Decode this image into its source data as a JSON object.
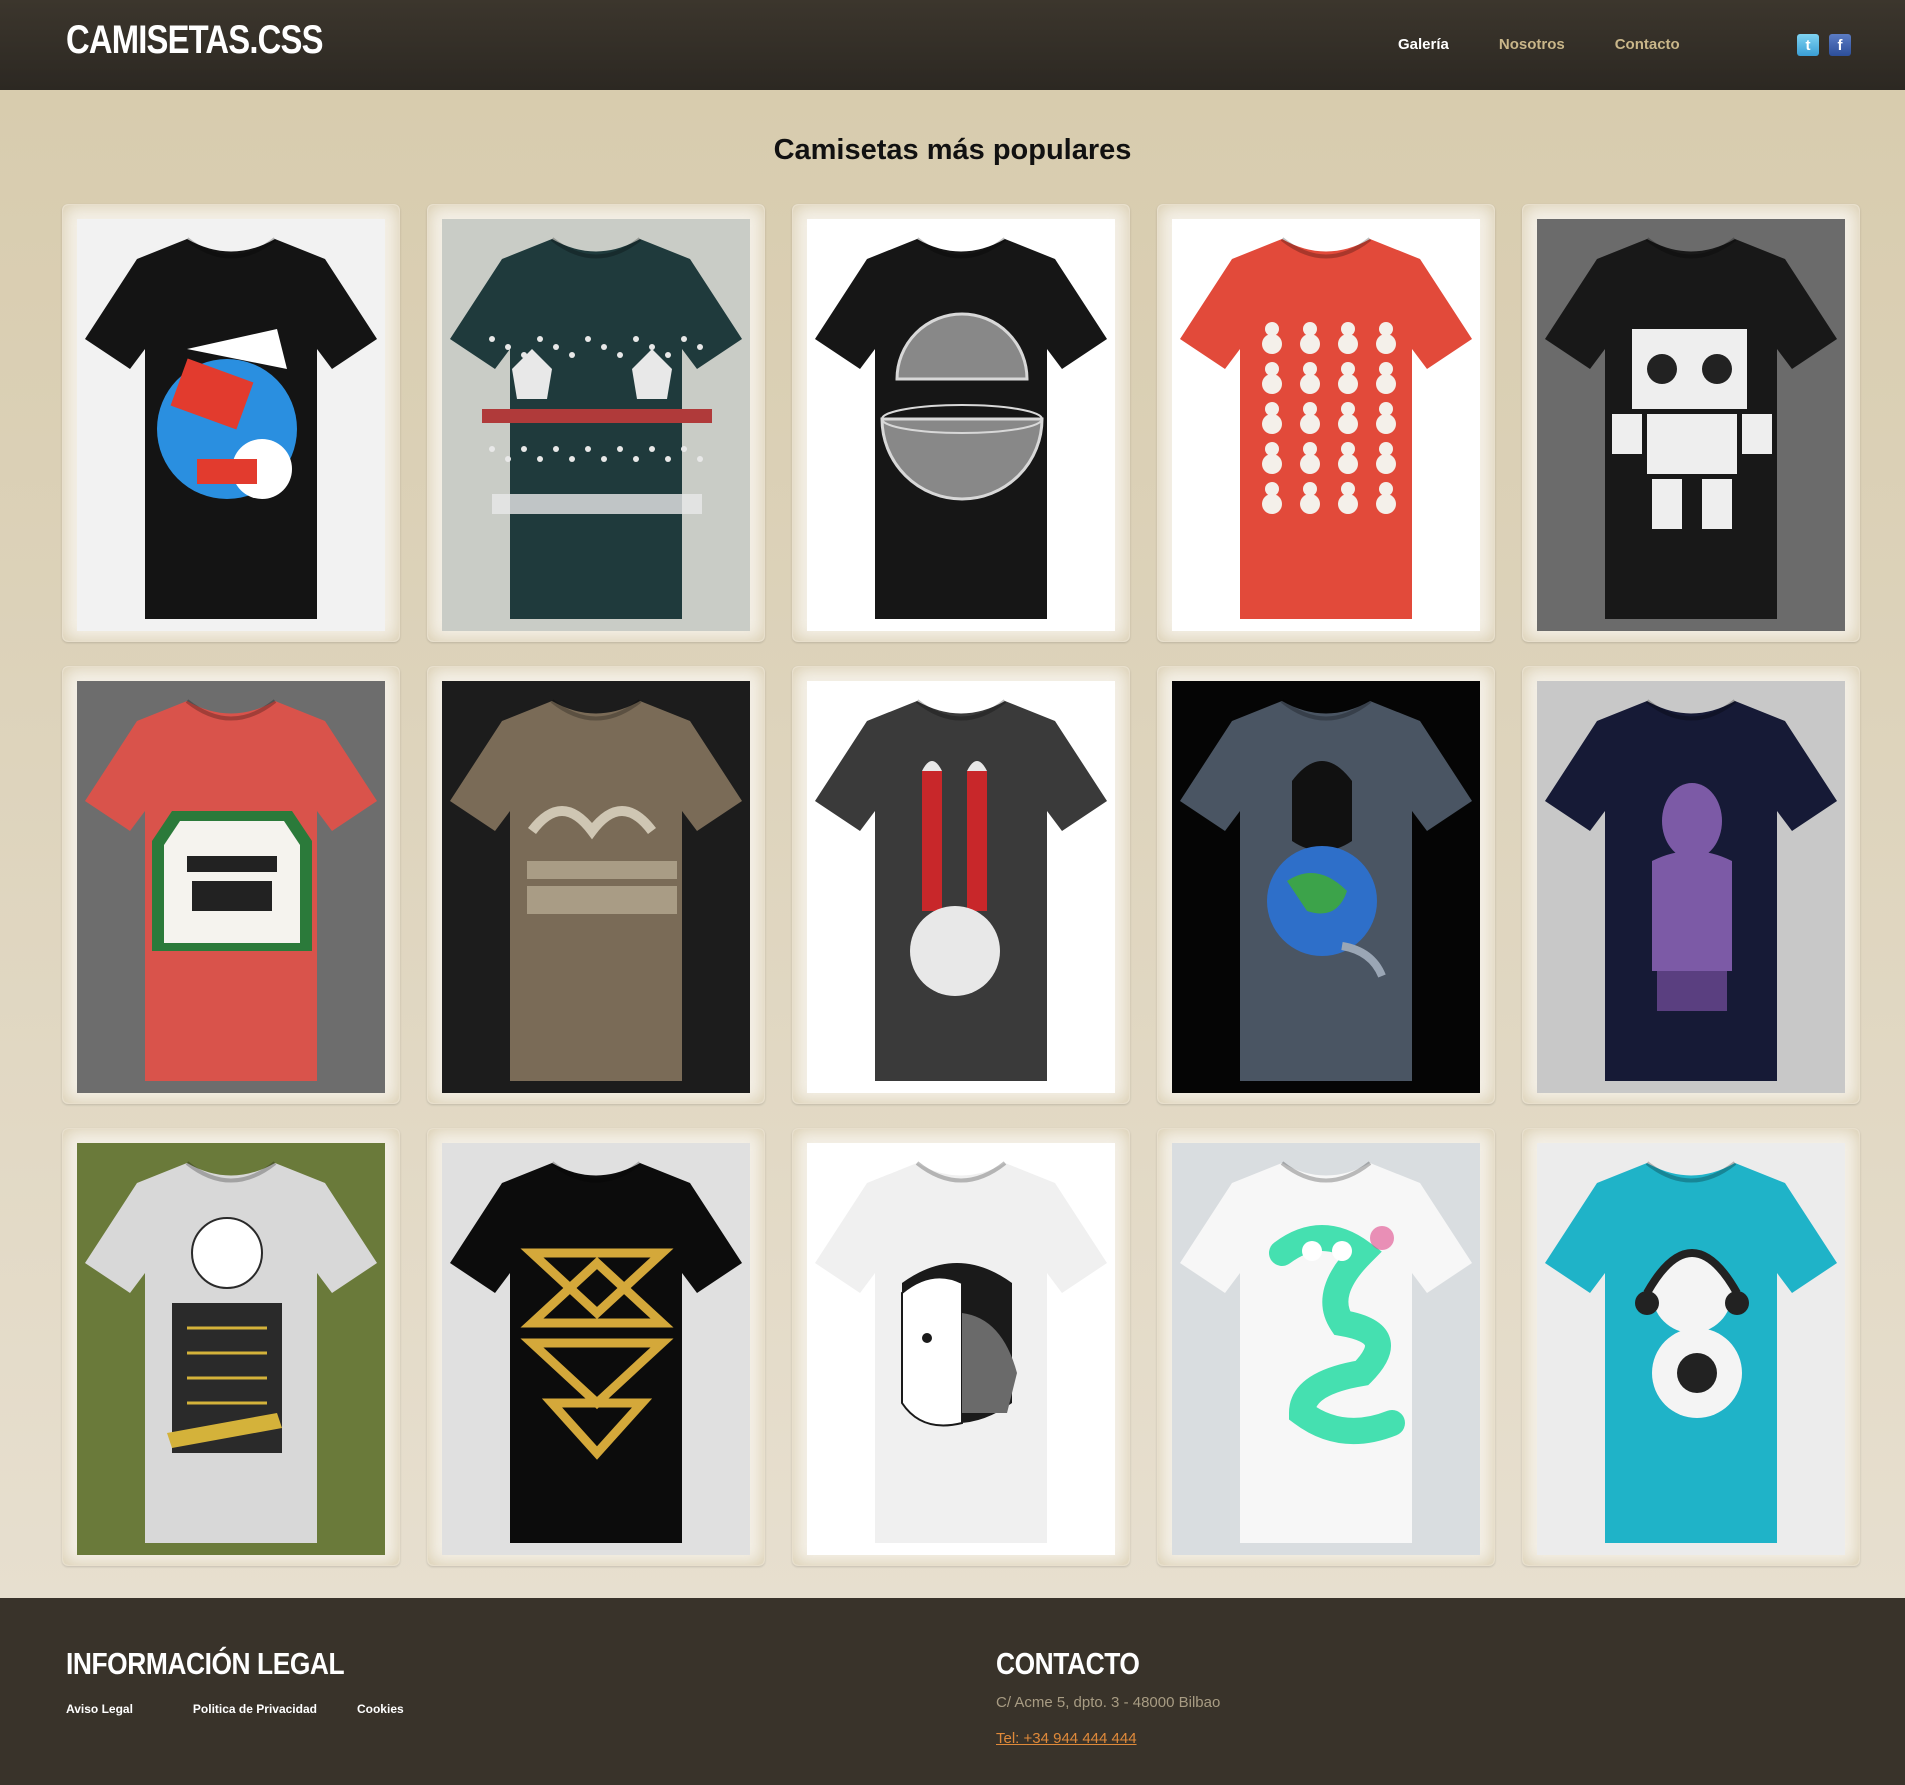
{
  "header": {
    "logo": "CAMISETAS.CSS",
    "nav": [
      {
        "label": "Galería",
        "active": true
      },
      {
        "label": "Nosotros",
        "active": false
      },
      {
        "label": "Contacto",
        "active": false
      }
    ],
    "social": {
      "twitter": "t",
      "facebook": "f"
    }
  },
  "main": {
    "title": "Camisetas más populares"
  },
  "shirts": [
    {
      "name": "abstract-colorful-black",
      "bg": "#f2f2f2",
      "shirt": "#141414",
      "print": "#2a8fe0",
      "print2": "#e23b2e",
      "motif": "abstract"
    },
    {
      "name": "reindeer-sweater-teal",
      "bg": "#c9ccc6",
      "shirt": "#1f3a3c",
      "print": "#e8e8e8",
      "print2": "#b03a3a",
      "motif": "reindeer"
    },
    {
      "name": "sphere-split-black",
      "bg": "#ffffff",
      "shirt": "#161616",
      "print": "#d8d8d8",
      "print2": "#888888",
      "motif": "sphere"
    },
    {
      "name": "snowmen-red",
      "bg": "#ffffff",
      "shirt": "#e24a3a",
      "print": "#f4f0ea",
      "print2": "#b33325",
      "motif": "snowmen"
    },
    {
      "name": "robot-black",
      "bg": "#6b6b6b",
      "shirt": "#181818",
      "print": "#eeeeee",
      "print2": "#222222",
      "motif": "robot"
    },
    {
      "name": "bassface-filthy-nasty",
      "bg": "#6d6d6d",
      "shirt": "#d9534b",
      "print": "#f5f3ee",
      "print2": "#2b7a3a",
      "motif": "label"
    },
    {
      "name": "better-than-i-deserve",
      "bg": "#1c1c1c",
      "shirt": "#7a6b57",
      "print": "#cfc6b3",
      "print2": "#a99c85",
      "motif": "text"
    },
    {
      "name": "rabbit-ears-gray",
      "bg": "#ffffff",
      "shirt": "#3a3a3a",
      "print": "#c8272a",
      "print2": "#e8e8e8",
      "motif": "rabbit"
    },
    {
      "name": "please-stop-earth",
      "bg": "#050505",
      "shirt": "#4a5563",
      "print": "#2e6fc9",
      "print2": "#3ca34a",
      "motif": "earth"
    },
    {
      "name": "purple-girl-navy",
      "bg": "#c8c8c8",
      "shirt": "#161a36",
      "print": "#7c5aa6",
      "print2": "#5a3f80",
      "motif": "figure"
    },
    {
      "name": "captain-illustration-gray",
      "bg": "#6a7a3a",
      "shirt": "#d8d8d8",
      "print": "#2a2a2a",
      "print2": "#d4b23a",
      "motif": "captain"
    },
    {
      "name": "gold-triangles-black",
      "bg": "#e0e0e0",
      "shirt": "#0c0c0c",
      "print": "#d4a83a",
      "print2": "#b08a2a",
      "motif": "triangles"
    },
    {
      "name": "boy-dog-white",
      "bg": "#ffffff",
      "shirt": "#f0f0f0",
      "print": "#1a1a1a",
      "print2": "#6a6a6a",
      "motif": "face"
    },
    {
      "name": "green-snake-white",
      "bg": "#d9dde0",
      "shirt": "#f7f7f7",
      "print": "#45e0b0",
      "print2": "#e04a8a",
      "motif": "snake"
    },
    {
      "name": "bear-headphones-cyan",
      "bg": "#ececec",
      "shirt": "#1fb3c8",
      "print": "#f4f4f4",
      "print2": "#222222",
      "motif": "bear"
    }
  ],
  "footer": {
    "legal_title": "INFORMACIÓN LEGAL",
    "legal_links": [
      "Aviso Legal",
      "Politica de Privacidad",
      "Cookies"
    ],
    "contact_title": "CONTACTO",
    "address": "C/ Acme 5, dpto. 3 - 48000 Bilbao",
    "phone": "Tel: +34 944 444 444"
  }
}
